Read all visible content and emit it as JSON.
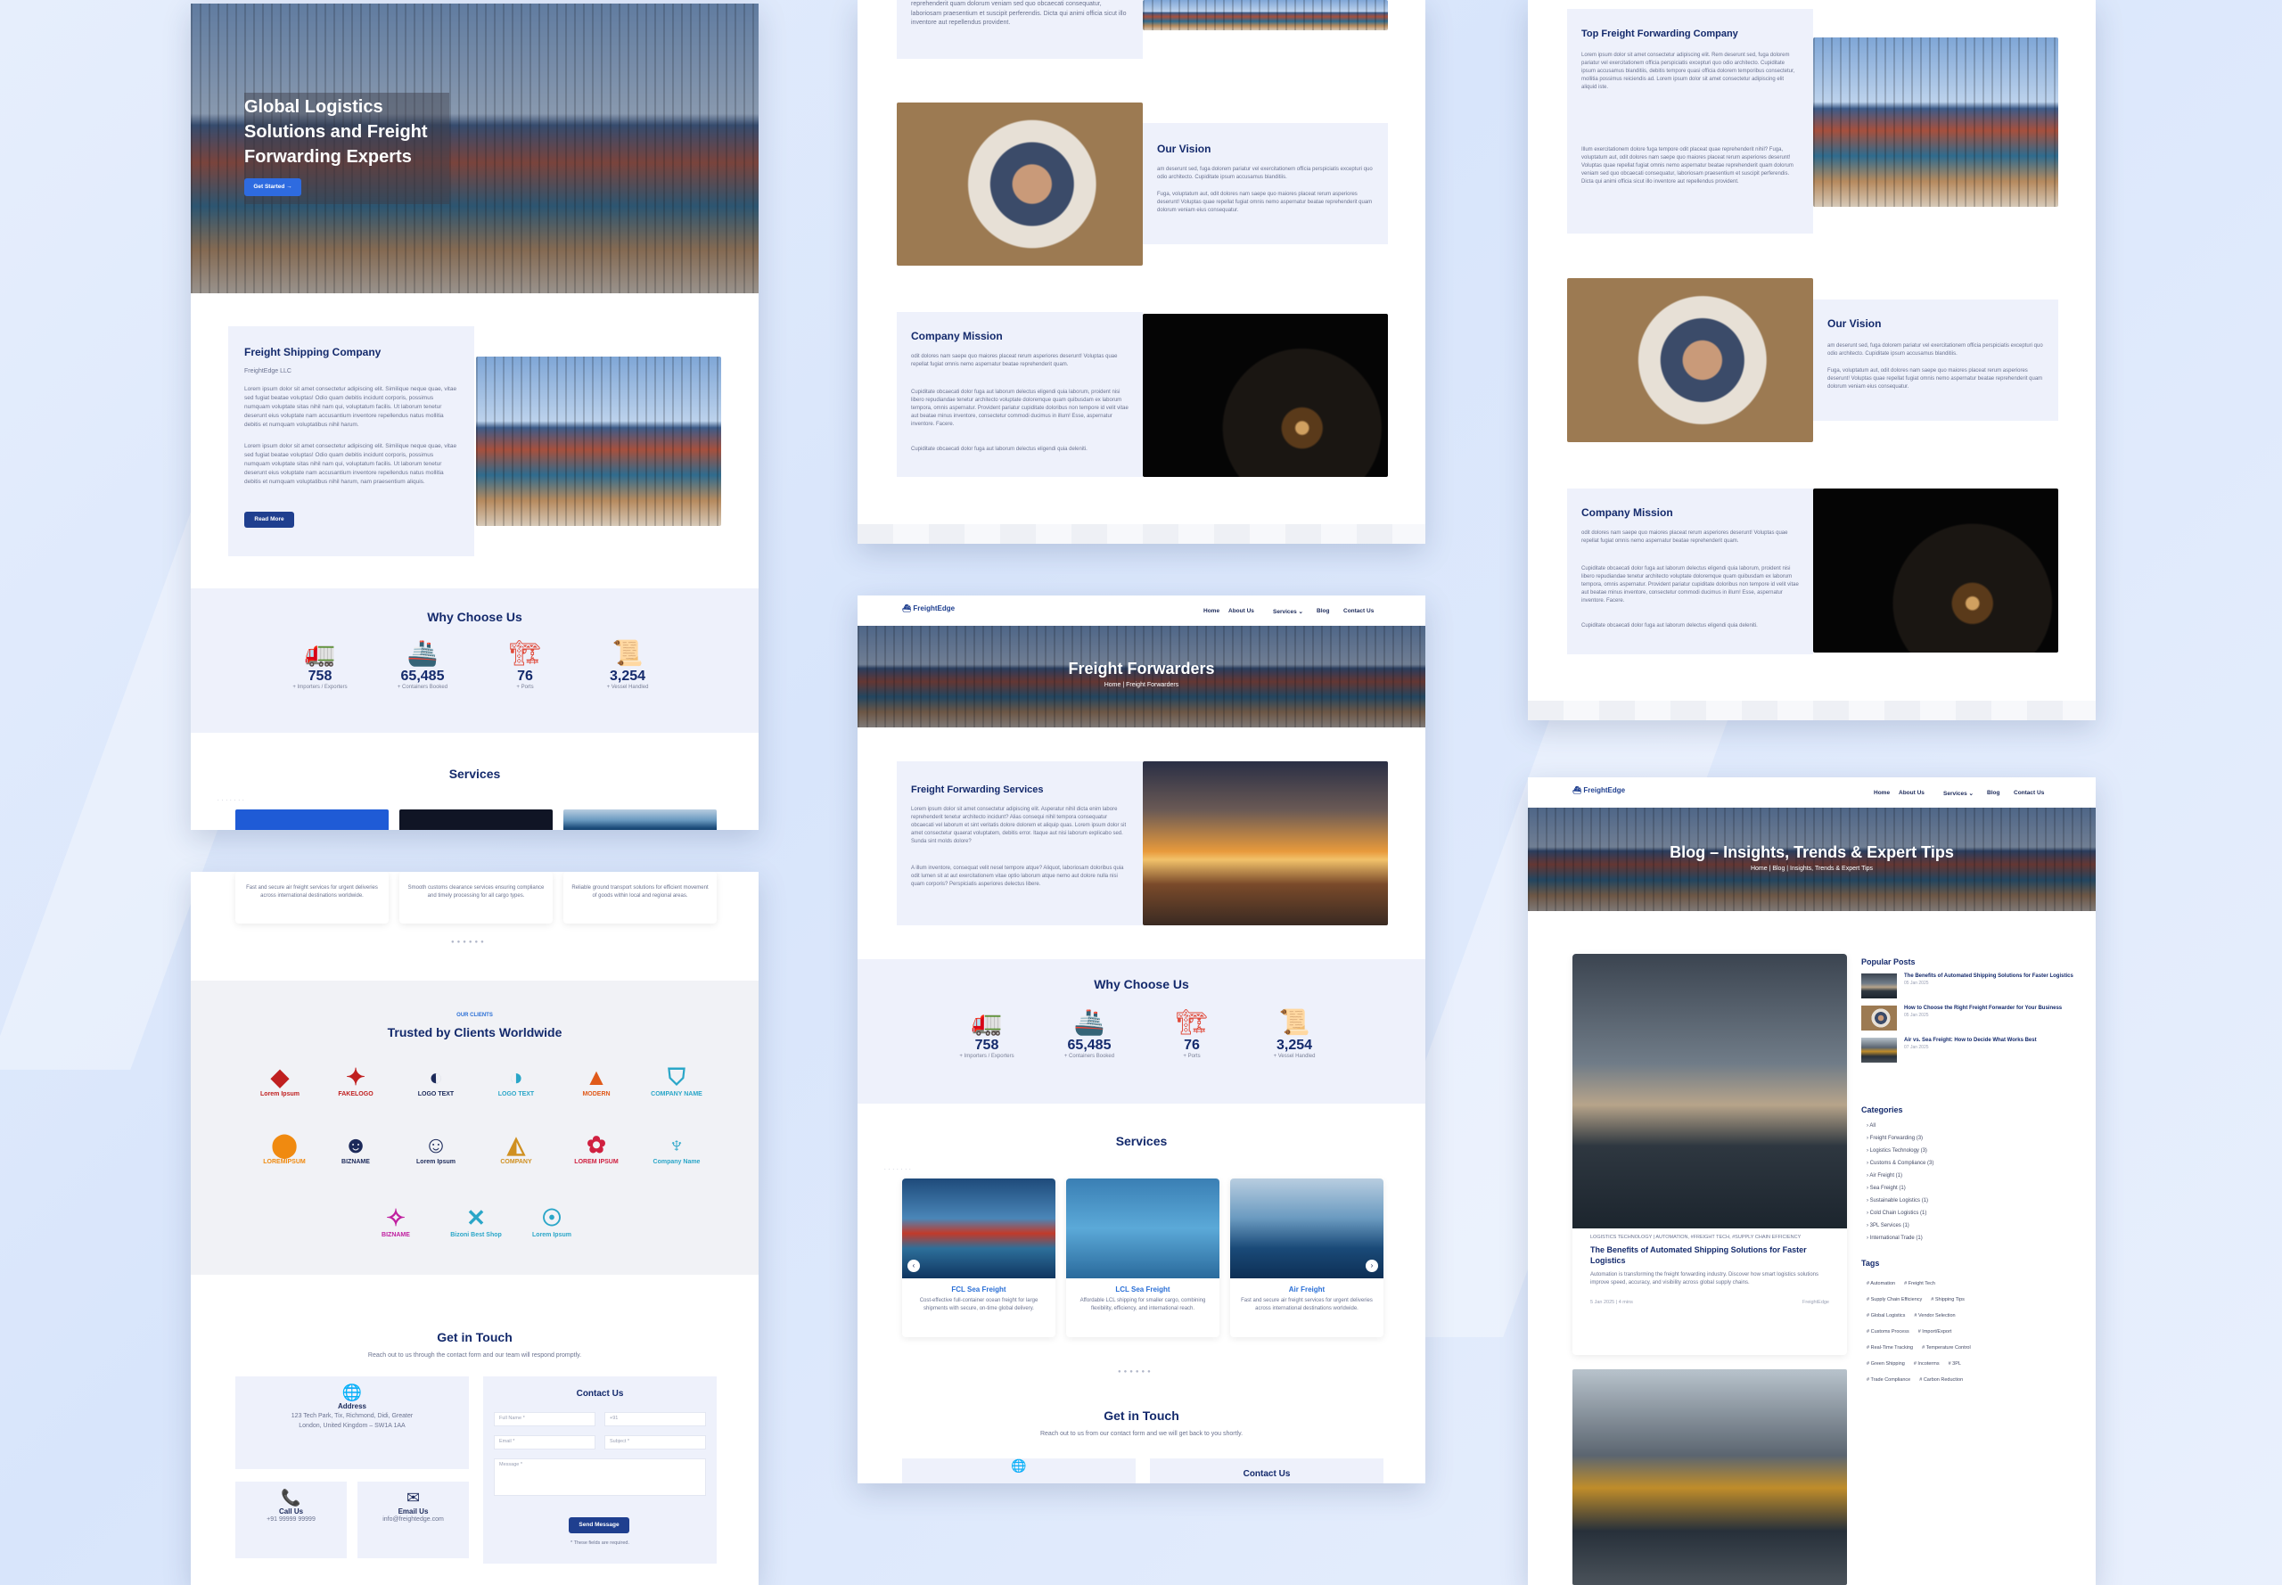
{
  "hero": {
    "title_line1": "Global Logistics",
    "title_line2": "Solutions and Freight",
    "title_line3": "Forwarding Experts",
    "button": "Get Started"
  },
  "about": {
    "title": "Freight Shipping Company",
    "subtitle": "FreightEdge LLC",
    "para1": "Lorem ipsum dolor sit amet consectetur adipiscing elit. Similique neque quae, vitae sed fugiat beatae voluptas! Odio quam debitis incidunt corporis, possimus numquam voluptate sitas nihil nam qui, voluptatum facilis. Ut laborum tenetur deserunt eius voluptate nam accusantium inventore repellendus natus mollitia debitis et numquam voluptatibus nihil harum.",
    "para2": "Lorem ipsum dolor sit amet consectetur adipiscing elit. Similique neque quae, vitae sed fugiat beatae voluptas! Odio quam debitis incidunt corporis, possimus numquam voluptate sitas nihil nam qui, voluptatum facilis. Ut laborum tenetur deserunt eius voluptate nam accusantium inventore repellendus natus mollitia debitis et numquam voluptatibus nihil harum, nam praesentium aliquis.",
    "button": "Read More"
  },
  "why": {
    "title": "Why Choose Us",
    "stats": [
      {
        "value": "758",
        "label": "+ Importers / Exporters"
      },
      {
        "value": "65,485",
        "label": "+ Containers Booked"
      },
      {
        "value": "76",
        "label": "+ Ports"
      },
      {
        "value": "3,254",
        "label": "+ Vessel Handled"
      }
    ]
  },
  "services": {
    "title": "Services",
    "cards": [
      {
        "title": "FCL Sea Freight",
        "desc": "Cost-effective full-container ocean freight for large shipments with secure, on-time global delivery."
      },
      {
        "title": "LCL Sea Freight",
        "desc": "Affordable LCL shipping for smaller cargo, combining flexibility, efficiency, and international reach."
      },
      {
        "title": "Air Freight",
        "desc": "Fast and secure air freight services for urgent deliveries across international destinations worldwide."
      }
    ],
    "snip1": "Fast and secure air freight services for urgent deliveries across international destinations worldwide.",
    "snip2": "Smooth customs clearance services ensuring compliance and timely processing for all cargo types.",
    "snip3": "Reliable ground transport solutions for efficient movement of goods within local and regional areas."
  },
  "clients": {
    "kicker": "OUR CLIENTS",
    "title": "Trusted by Clients Worldwide",
    "logos": [
      "Lorem Ipsum",
      "FAKELOGO",
      "LOGO TEXT",
      "LOGO TEXT",
      "MODERN",
      "COMPANY NAME",
      "LOREMIPSUM",
      "BIZNAME",
      "Lorem Ipsum",
      "COMPANY",
      "LOREM IPSUM",
      "Company Name",
      "BIZNAME",
      "Bizoni Best Shop",
      "Lorem Ipsum"
    ]
  },
  "contact": {
    "title": "Get in Touch",
    "subtitle": "Reach out to us through the contact form and our team will respond promptly.",
    "subtitle2": "Reach out to us from our contact form and we will get back to you shortly.",
    "address_label": "Address",
    "address": "123 Tech Park, Tix, Richmond, Didi, Greater London, United Kingdom – SW1A 1AA",
    "call_label": "Call Us",
    "phone": "+91 99999 99999",
    "email_label": "Email Us",
    "email": "info@freightedge.com",
    "form_title": "Contact Us",
    "ph_name": "Full Name *",
    "ph_phone": "+91",
    "ph_email": "Email *",
    "ph_subject": "Subject *",
    "ph_message": "Message *",
    "send": "Send Message",
    "note": "* These fields are required."
  },
  "top": {
    "text1": "reprehenderit quam dolorum veniam sed quo obcaecati consequatur, laboriosam praesentium et suscipit perferendis. Dicta qui animi officia sicut illo inventore aut repellendus provident."
  },
  "vision": {
    "title": "Our Vision",
    "p1": "am deserunt sed, fuga dolorem pariatur vel exercitationem officia perspiciatis excepturi quo odio architecto. Cupiditate ipsum accusamus blanditiis.",
    "p2": "Fuga, voluptatum aut, odit dolores nam saepe quo maiores placeat rerum asperiores deserunt! Voluptas quae repellat fugiat omnis nemo aspernatur beatae reprehenderit quam dolorum veniam eius consequatur."
  },
  "mission": {
    "title": "Company Mission",
    "p1": "odit dolores nam saepe quo maiores placeat rerum asperiores deserunt! Voluptas quae repellat fugiat omnis nemo aspernatur beatae reprehenderit quam.",
    "p2": "Cupiditate obcaecati dolor fuga aut laborum delectus eligendi quia laborum, proident nisi libero repudiandae tenetur architecto voluptate doloremque quam quibusdam ex laborum tempora, omnis aspernatur. Provident pariatur cupiditate doloribus non tempore id velit vitae aut beatae minus inventore, consectetur commodi ducimus in illum! Esse, aspernatur inventore. Facere.",
    "p3": "Cupiditate obcaecati dolor fuga aut laborum delectus eligendi quia deleniti."
  },
  "nav": {
    "brand": "FreightEdge",
    "home": "Home",
    "about": "About Us",
    "services": "Services ⌄",
    "blog": "Blog",
    "contact": "Contact Us"
  },
  "ff": {
    "banner": "Freight Forwarders",
    "crumb": "Home | Freight Forwarders",
    "title": "Freight Forwarding Services",
    "p1": "Lorem ipsum dolor sit amet consectetur adipiscing elit. Asperatur nihil dicta enim labore reprehenderit tenetur architecto incidunt? Alias consequi nihil tempora consequatur obcaecati vel laborum et sint veritatis dolore dolorem et aliquip quas. Lorem ipsum dolor sit amet consectetur quaerat voluptatem, debitis error. Itaque aut nisi laborum explicabo sed. Sunda sint molds dolore?",
    "p2": "A illum inventore, consequat velit nesel tempore atque? Aliquot, laboriosam doloribus quia odit lumen sit at aut exercitationem vitae optio laborum atque nemo aut dolore nulla nisi quam corporis? Perspiciatis asperiores delectus libere."
  },
  "topfreight": {
    "title": "Top Freight Forwarding Company",
    "p1": "Lorem ipsum dolor sit amet consectetur adipiscing elit. Rem deserunt sed, fuga dolorem pariatur vel exercitationem officia perspiciatis excepturi quo odio architecto. Cupiditate ipsum accusamus blanditiis, debitis tempore quasi officia dolorem temporibus consectetur, mollitia possimus reiciendis ad. Lorem ipsum dolor sit amet consectetur adipiscing elit aliquid iste.",
    "p2": "Illum exercitationem dolore fuga tempore odit placeat quae reprehenderit nihil? Fuga, voluptatum aut, odit dolores nam saepe quo maiores placeat rerum asperiores deserunt! Voluptas quae repellat fugiat omnis nemo aspernatur beatae reprehenderit quam dolorum veniam sed quo obcaecati consequatur, laboriosam praesentium et suscipit perferendis. Dicta qui animi officia sicut illo inventore aut repellendus provident."
  },
  "blog": {
    "banner": "Blog – Insights, Trends & Expert Tips",
    "crumb": "Home | Blog | Insights, Trends & Expert Tips",
    "cats_meta": "LOGISTICS TECHNOLOGY | AUTOMATION, #FREIGHT TECH, #SUPPLY CHAIN EFFICIENCY",
    "post_title": "The Benefits of Automated Shipping Solutions for Faster Logistics",
    "post_desc": "Automation is transforming the freight forwarding industry. Discover how smart logistics solutions improve speed, accuracy, and visibility across global supply chains.",
    "post_date": "5 Jan 2025 | 4 mins",
    "post_author": "FreightEdge",
    "popular_title": "Popular Posts",
    "popular": [
      {
        "t": "The Benefits of Automated Shipping Solutions for Faster Logistics",
        "d": "05 Jan 2025"
      },
      {
        "t": "How to Choose the Right Freight Forwarder for Your Business",
        "d": "05 Jan 2025"
      },
      {
        "t": "Air vs. Sea Freight: How to Decide What Works Best",
        "d": "07 Jan 2025"
      }
    ],
    "categories_title": "Categories",
    "categories": [
      "All",
      "Freight Forwarding (3)",
      "Logistics Technology (3)",
      "Customs & Compliance (3)",
      "Air Freight (1)",
      "Sea Freight (1)",
      "Sustainable Logistics (1)",
      "Cold Chain Logistics (1)",
      "3PL Services (1)",
      "International Trade (1)"
    ],
    "tags_title": "Tags",
    "tags": [
      "Automation",
      "Freight Tech",
      "Supply Chain Efficiency",
      "Shipping Tips",
      "Global Logistics",
      "Vendor Selection",
      "Customs Process",
      "Import/Export",
      "Real-Time Tracking",
      "Temperature Control",
      "Green Shipping",
      "Incoterms",
      "3PL",
      "Trade Compliance",
      "Carbon Reduction"
    ]
  }
}
